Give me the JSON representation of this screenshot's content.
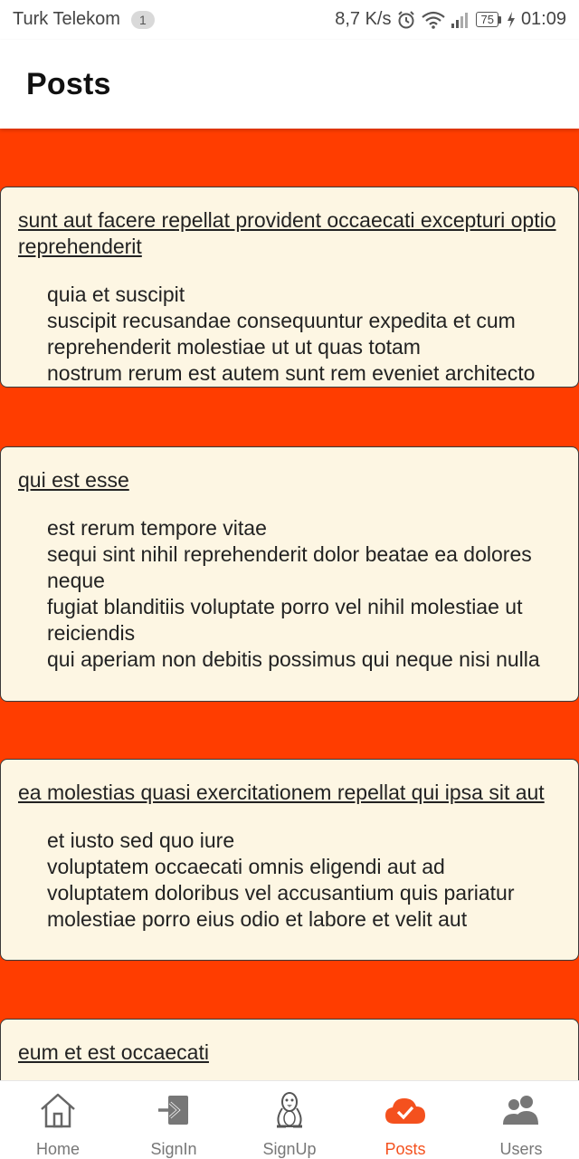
{
  "status_bar": {
    "carrier": "Turk Telekom",
    "notification_count": "1",
    "net_speed": "8,7 K/s",
    "battery": "75",
    "time": "01:09"
  },
  "header": {
    "title": "Posts"
  },
  "posts": [
    {
      "title": "sunt aut facere repellat provident occaecati excepturi optio reprehenderit",
      "body": "quia et suscipit\nsuscipit recusandae consequuntur expedita et cum reprehenderit molestiae ut ut quas totam\nnostrum rerum est autem sunt rem eveniet architecto"
    },
    {
      "title": "qui est esse",
      "body": "est rerum tempore vitae\nsequi sint nihil reprehenderit dolor beatae ea dolores neque\nfugiat blanditiis voluptate porro vel nihil molestiae ut reiciendis\nqui aperiam non debitis possimus qui neque nisi nulla"
    },
    {
      "title": "ea molestias quasi exercitationem repellat qui ipsa sit aut",
      "body": "et iusto sed quo iure\nvoluptatem occaecati omnis eligendi aut ad\nvoluptatem doloribus vel accusantium quis pariatur\nmolestiae porro eius odio et labore et velit aut"
    },
    {
      "title": "eum et est occaecati",
      "body": ""
    }
  ],
  "bottom_nav": {
    "items": [
      {
        "label": "Home",
        "icon": "home-icon",
        "active": false
      },
      {
        "label": "SignIn",
        "icon": "sign-in-icon",
        "active": false
      },
      {
        "label": "SignUp",
        "icon": "linux-penguin-icon",
        "active": false
      },
      {
        "label": "Posts",
        "icon": "cloud-check-icon",
        "active": true
      },
      {
        "label": "Users",
        "icon": "users-icon",
        "active": false
      }
    ]
  },
  "colors": {
    "content_background": "#ff3d00",
    "card_background": "#fdf6e3",
    "active_nav": "#f4511e"
  }
}
